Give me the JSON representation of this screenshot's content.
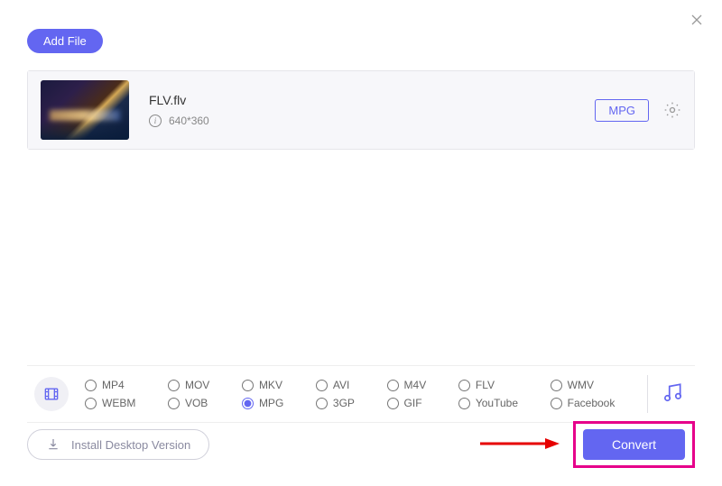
{
  "buttons": {
    "addFile": "Add File",
    "installDesktop": "Install Desktop Version",
    "convert": "Convert"
  },
  "file": {
    "name": "FLV.flv",
    "resolution": "640*360",
    "outputFormat": "MPG"
  },
  "formats": {
    "row1": [
      "MP4",
      "MOV",
      "MKV",
      "AVI",
      "M4V",
      "FLV",
      "WMV"
    ],
    "row2": [
      "WEBM",
      "VOB",
      "MPG",
      "3GP",
      "GIF",
      "YouTube",
      "Facebook"
    ],
    "selected": "MPG"
  }
}
